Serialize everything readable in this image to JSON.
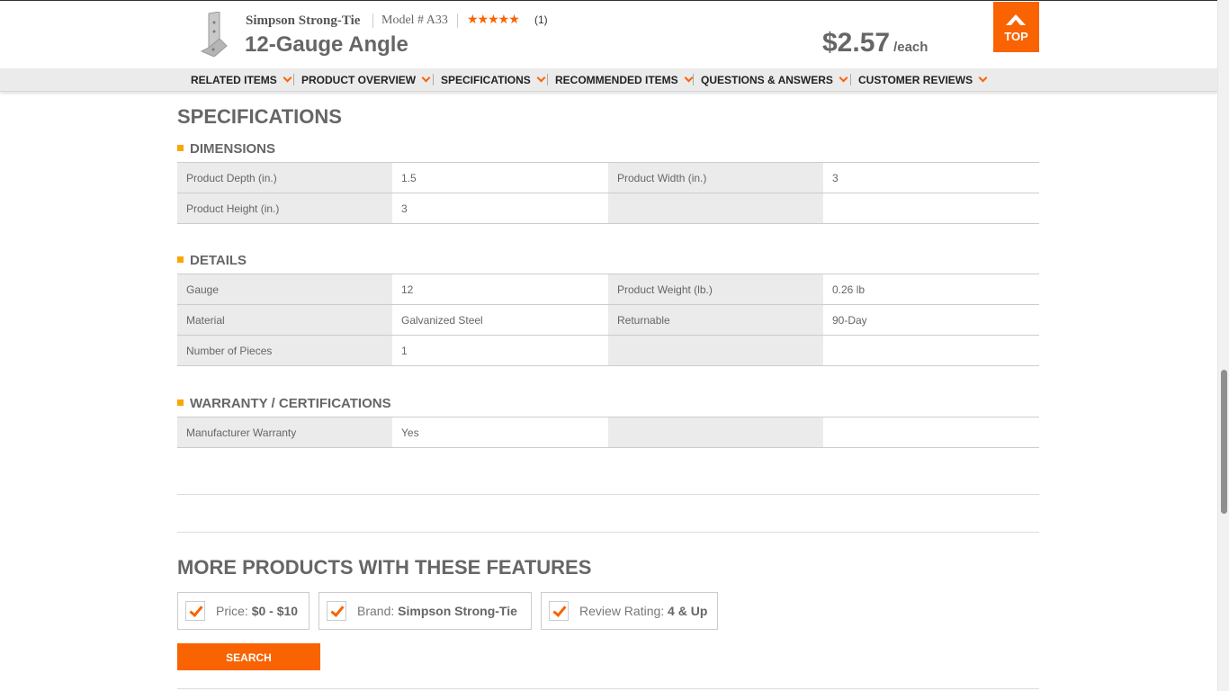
{
  "header": {
    "brand": "Simpson Strong-Tie",
    "model": "Model # A33",
    "stars": "★★★★★",
    "review_count": "(1)",
    "title": "12-Gauge Angle",
    "price": "$2.57",
    "price_unit": "/each",
    "top_label": "TOP"
  },
  "nav": {
    "items": [
      "RELATED ITEMS",
      "PRODUCT OVERVIEW",
      "SPECIFICATIONS",
      "RECOMMENDED ITEMS",
      "QUESTIONS & ANSWERS",
      "CUSTOMER REVIEWS"
    ]
  },
  "specs": {
    "title": "SPECIFICATIONS",
    "dimensions": {
      "heading": "DIMENSIONS",
      "rows": [
        [
          "Product Depth (in.)",
          "1.5",
          "Product Width (in.)",
          "3"
        ],
        [
          "Product Height (in.)",
          "3",
          "",
          ""
        ]
      ]
    },
    "details": {
      "heading": "DETAILS",
      "rows": [
        [
          "Gauge",
          "12",
          "Product Weight (lb.)",
          "0.26 lb"
        ],
        [
          "Material",
          "Galvanized Steel",
          "Returnable",
          "90-Day"
        ],
        [
          "Number of Pieces",
          "1",
          "",
          ""
        ]
      ]
    },
    "warranty": {
      "heading": "WARRANTY / CERTIFICATIONS",
      "rows": [
        [
          "Manufacturer Warranty",
          "Yes",
          "",
          ""
        ]
      ]
    }
  },
  "more": {
    "title": "MORE PRODUCTS WITH THESE FEATURES",
    "filters": [
      {
        "label": "Price:",
        "value": "$0 - $10"
      },
      {
        "label": "Brand:",
        "value": "Simpson Strong-Tie"
      },
      {
        "label": "Review Rating:",
        "value": "4 & Up"
      }
    ],
    "search_label": "SEARCH"
  },
  "colors": {
    "accent": "#f96302",
    "bullet": "#f9a602"
  }
}
